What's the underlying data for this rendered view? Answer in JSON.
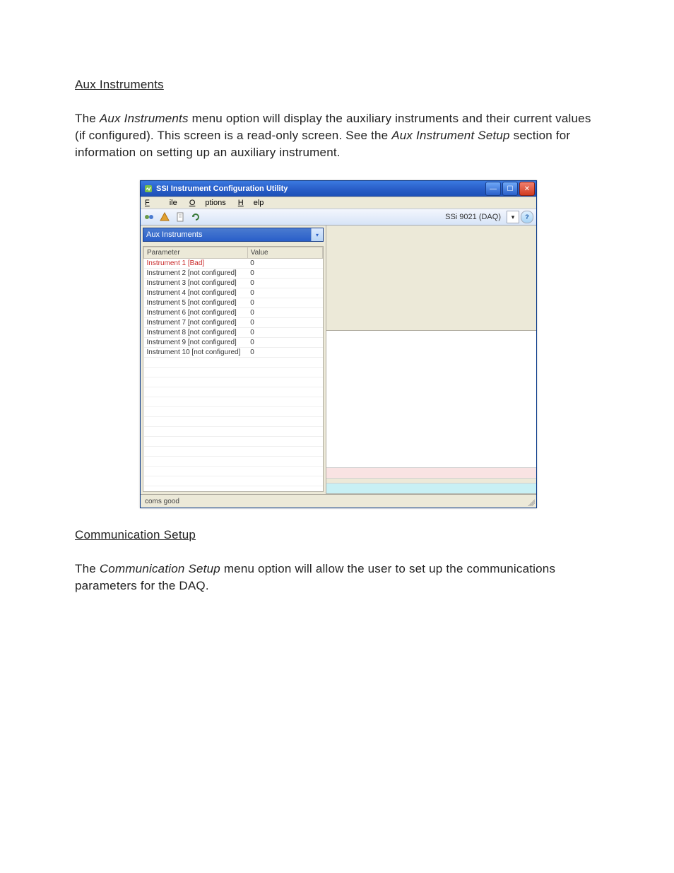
{
  "doc": {
    "heading_aux": "Aux Instruments",
    "para1_a": "The ",
    "para1_b": "Aux Instruments",
    "para1_c": " menu option will display the auxiliary instruments and their current values (if configured).  This screen is a read-only screen.  See the ",
    "para1_d": "Aux Instrument  Setup",
    "para1_e": " section for information on setting up an auxiliary instrument.",
    "heading_comm": "Communication Setup",
    "para2_a": "The ",
    "para2_b": "Communication Setup",
    "para2_c": " menu option will allow the user to set up the communications parameters for the DAQ."
  },
  "win": {
    "title": "SSI Instrument Configuration Utility",
    "menus": {
      "file": "File",
      "options": "Options",
      "help": "Help"
    },
    "device": "SSi 9021 (DAQ)",
    "section_label": "Aux Instruments",
    "grid": {
      "col_param": "Parameter",
      "col_value": "Value",
      "rows": [
        {
          "param": "Instrument 1 [Bad]",
          "value": "0",
          "bad": true
        },
        {
          "param": "Instrument 2 [not configured]",
          "value": "0"
        },
        {
          "param": "Instrument 3 [not configured]",
          "value": "0"
        },
        {
          "param": "Instrument 4 [not configured]",
          "value": "0"
        },
        {
          "param": "Instrument 5 [not configured]",
          "value": "0"
        },
        {
          "param": "Instrument 6 [not configured]",
          "value": "0"
        },
        {
          "param": "Instrument 7 [not configured]",
          "value": "0"
        },
        {
          "param": "Instrument 8 [not configured]",
          "value": "0"
        },
        {
          "param": "Instrument 9 [not configured]",
          "value": "0"
        },
        {
          "param": "Instrument 10 [not configured]",
          "value": "0"
        }
      ]
    },
    "status": "coms good"
  }
}
